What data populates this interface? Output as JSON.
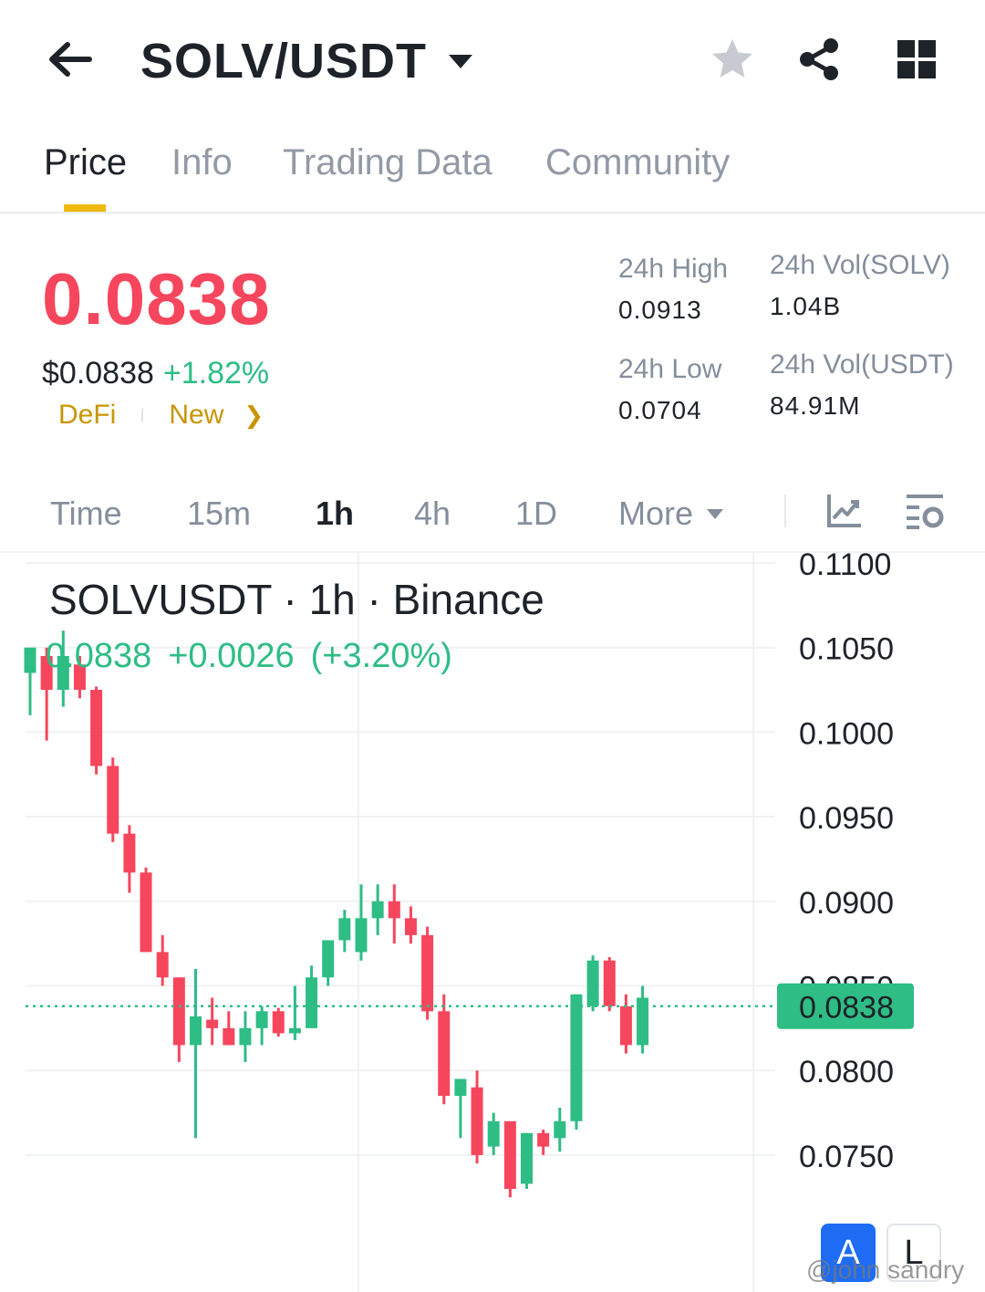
{
  "header": {
    "pair": "SOLV/USDT",
    "icons": [
      "back-arrow-icon",
      "caret-down-icon",
      "star-icon",
      "share-icon",
      "grid-icon"
    ]
  },
  "tabs": [
    {
      "label": "Price",
      "active": true
    },
    {
      "label": "Info",
      "active": false
    },
    {
      "label": "Trading Data",
      "active": false
    },
    {
      "label": "Community",
      "active": false
    }
  ],
  "price": {
    "last": "0.0838",
    "usd": "$0.0838",
    "change": "+1.82%",
    "tags": [
      "DeFi",
      "New"
    ]
  },
  "stats": {
    "high_label": "24h High",
    "high_value": "0.0913",
    "low_label": "24h Low",
    "low_value": "0.0704",
    "vol_base_label": "24h Vol(SOLV)",
    "vol_base_value": "1.04B",
    "vol_quote_label": "24h Vol(USDT)",
    "vol_quote_value": "84.91M"
  },
  "intervals": {
    "items": [
      "Time",
      "15m",
      "1h",
      "4h",
      "1D"
    ],
    "active": "1h",
    "more": "More"
  },
  "chart_data": {
    "type": "candlestick",
    "title": "SOLVUSDT · 1h · Binance",
    "ohlc_close": "0.0838",
    "ohlc_change": "+0.0026",
    "ohlc_change_pct": "(+3.20%)",
    "y_ticks": [
      "0.1100",
      "0.1050",
      "0.1000",
      "0.0950",
      "0.0900",
      "0.0850",
      "0.0800",
      "0.0750"
    ],
    "y_tick_values": [
      0.11,
      0.105,
      0.1,
      0.095,
      0.09,
      0.085,
      0.08,
      0.075
    ],
    "last_price_label": "0.0838",
    "last_price_value": 0.0838,
    "colors": {
      "up": "#2ebd85",
      "down": "#f6465d"
    },
    "candles": [
      {
        "o": 0.1035,
        "h": 0.1045,
        "l": 0.101,
        "c": 0.105
      },
      {
        "o": 0.1045,
        "h": 0.105,
        "l": 0.0995,
        "c": 0.1025
      },
      {
        "o": 0.1025,
        "h": 0.106,
        "l": 0.1015,
        "c": 0.1045
      },
      {
        "o": 0.104,
        "h": 0.1045,
        "l": 0.102,
        "c": 0.1025
      },
      {
        "o": 0.1025,
        "h": 0.1027,
        "l": 0.0975,
        "c": 0.098
      },
      {
        "o": 0.098,
        "h": 0.0985,
        "l": 0.0935,
        "c": 0.094
      },
      {
        "o": 0.094,
        "h": 0.0945,
        "l": 0.0905,
        "c": 0.0917
      },
      {
        "o": 0.0917,
        "h": 0.092,
        "l": 0.087,
        "c": 0.087
      },
      {
        "o": 0.087,
        "h": 0.088,
        "l": 0.085,
        "c": 0.0855
      },
      {
        "o": 0.0855,
        "h": 0.0855,
        "l": 0.0805,
        "c": 0.0815
      },
      {
        "o": 0.0815,
        "h": 0.086,
        "l": 0.076,
        "c": 0.0832
      },
      {
        "o": 0.083,
        "h": 0.0843,
        "l": 0.0815,
        "c": 0.0825
      },
      {
        "o": 0.0825,
        "h": 0.0835,
        "l": 0.0815,
        "c": 0.0815
      },
      {
        "o": 0.0815,
        "h": 0.0835,
        "l": 0.0805,
        "c": 0.0825
      },
      {
        "o": 0.0825,
        "h": 0.0838,
        "l": 0.0815,
        "c": 0.0835
      },
      {
        "o": 0.0835,
        "h": 0.0837,
        "l": 0.082,
        "c": 0.0822
      },
      {
        "o": 0.0822,
        "h": 0.085,
        "l": 0.0818,
        "c": 0.0825
      },
      {
        "o": 0.0825,
        "h": 0.0862,
        "l": 0.0825,
        "c": 0.0855
      },
      {
        "o": 0.0855,
        "h": 0.087,
        "l": 0.085,
        "c": 0.0877
      },
      {
        "o": 0.0877,
        "h": 0.0895,
        "l": 0.087,
        "c": 0.089
      },
      {
        "o": 0.087,
        "h": 0.091,
        "l": 0.0865,
        "c": 0.089
      },
      {
        "o": 0.089,
        "h": 0.091,
        "l": 0.088,
        "c": 0.09
      },
      {
        "o": 0.09,
        "h": 0.091,
        "l": 0.0875,
        "c": 0.089
      },
      {
        "o": 0.089,
        "h": 0.0897,
        "l": 0.0875,
        "c": 0.088
      },
      {
        "o": 0.088,
        "h": 0.0885,
        "l": 0.083,
        "c": 0.0835
      },
      {
        "o": 0.0835,
        "h": 0.0845,
        "l": 0.078,
        "c": 0.0785
      },
      {
        "o": 0.0785,
        "h": 0.0795,
        "l": 0.076,
        "c": 0.0795
      },
      {
        "o": 0.079,
        "h": 0.08,
        "l": 0.0745,
        "c": 0.075
      },
      {
        "o": 0.0755,
        "h": 0.0775,
        "l": 0.075,
        "c": 0.077
      },
      {
        "o": 0.077,
        "h": 0.077,
        "l": 0.0725,
        "c": 0.073
      },
      {
        "o": 0.0733,
        "h": 0.0763,
        "l": 0.073,
        "c": 0.0763
      },
      {
        "o": 0.0763,
        "h": 0.0765,
        "l": 0.075,
        "c": 0.0755
      },
      {
        "o": 0.076,
        "h": 0.0778,
        "l": 0.0752,
        "c": 0.077
      },
      {
        "o": 0.077,
        "h": 0.0845,
        "l": 0.0765,
        "c": 0.0845
      },
      {
        "o": 0.0838,
        "h": 0.0868,
        "l": 0.0835,
        "c": 0.0865
      },
      {
        "o": 0.0865,
        "h": 0.0867,
        "l": 0.0835,
        "c": 0.0838
      },
      {
        "o": 0.0838,
        "h": 0.0845,
        "l": 0.081,
        "c": 0.0815
      },
      {
        "o": 0.0815,
        "h": 0.085,
        "l": 0.081,
        "c": 0.0843
      }
    ]
  },
  "chart_badges": {
    "left": "A",
    "right": "L"
  },
  "watermark": "@john sandry"
}
